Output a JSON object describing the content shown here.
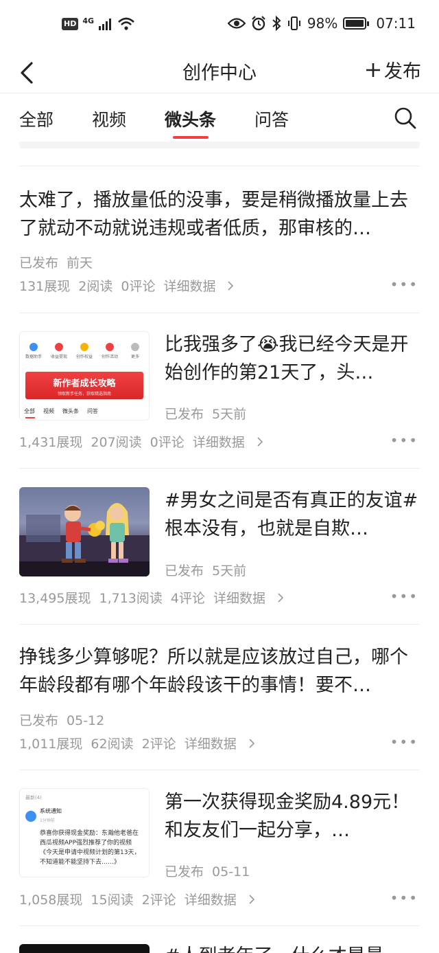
{
  "status_bar": {
    "hd_label": "HD",
    "network": "4G",
    "battery_text": "98%",
    "battery_level": 0.98,
    "time": "07:11"
  },
  "nav": {
    "title": "创作中心",
    "publish_label": "发布"
  },
  "tabs": [
    {
      "label": "全部",
      "active": false
    },
    {
      "label": "视频",
      "active": false
    },
    {
      "label": "微头条",
      "active": true
    },
    {
      "label": "问答",
      "active": false
    }
  ],
  "posts": [
    {
      "title": "太难了，播放量低的没事，要是稍微播放量上去了就动不动就说违规或者低质，那审核的…",
      "status": "已发布",
      "date": "前天",
      "views": "131展现",
      "reads": "2阅读",
      "comments": "0评论",
      "detail": "详细数据"
    },
    {
      "title": "比我强多了😭我已经今天是开始创作的第21天了，头…",
      "status": "已发布",
      "date": "5天前",
      "views": "1,431展现",
      "reads": "207阅读",
      "comments": "0评论",
      "detail": "详细数据",
      "thumb": {
        "icons": [
          "数据助手",
          "收益提现",
          "创作权益",
          "创作活动",
          "更多"
        ],
        "banner": "新作者成长攻略",
        "banner_sub": "领取新手任务，获取精选指南",
        "tabs": [
          "全部",
          "视频",
          "微头条",
          "问答"
        ]
      }
    },
    {
      "title": "#男女之间是否有真正的友谊# 根本没有，也就是自欺…",
      "status": "已发布",
      "date": "5天前",
      "views": "13,495展现",
      "reads": "1,713阅读",
      "comments": "4评论",
      "detail": "详细数据"
    },
    {
      "title": "挣钱多少算够呢？所以就是应该放过自己，哪个年龄段都有哪个年龄段该干的事情！要不…",
      "status": "已发布",
      "date": "05-12",
      "views": "1,011展现",
      "reads": "62阅读",
      "comments": "2评论",
      "detail": "详细数据"
    },
    {
      "title": "第一次获得现金奖励4.89元！和友友们一起分享，…",
      "status": "已发布",
      "date": "05-11",
      "views": "1,058展现",
      "reads": "15阅读",
      "comments": "2评论",
      "detail": "详细数据",
      "thumb": {
        "header": "最新(4)",
        "sender": "系统通知",
        "time": "1分钟前",
        "body": "恭喜你获得现金奖励：东瀚他老爸在西瓜视频APP强烈推荐了你的视频《今天是申请中视频计划的第13天，不知道能不能坚持下去……》"
      }
    }
  ],
  "next_post_title": "#人到老年了，什么才是最大…"
}
